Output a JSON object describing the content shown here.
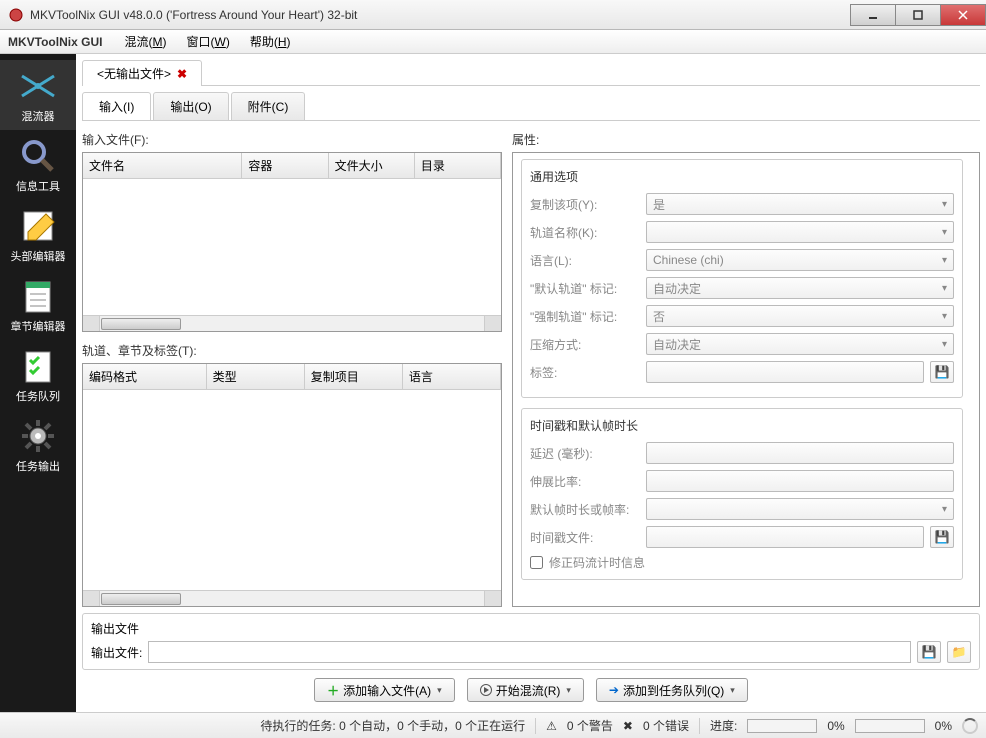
{
  "window": {
    "title": "MKVToolNix GUI v48.0.0 ('Fortress Around Your Heart') 32-bit"
  },
  "menubar": {
    "app_name": "MKVToolNix GUI",
    "items": [
      {
        "label": "混流",
        "accel": "M"
      },
      {
        "label": "窗口",
        "accel": "W"
      },
      {
        "label": "帮助",
        "accel": "H"
      }
    ]
  },
  "sidebar": {
    "items": [
      {
        "label": "混流器",
        "icon": "mux"
      },
      {
        "label": "信息工具",
        "icon": "info"
      },
      {
        "label": "头部编辑器",
        "icon": "header"
      },
      {
        "label": "章节编辑器",
        "icon": "chapter"
      },
      {
        "label": "任务队列",
        "icon": "queue"
      },
      {
        "label": "任务输出",
        "icon": "output"
      }
    ]
  },
  "doc_tab": {
    "label": "<无输出文件>"
  },
  "inner_tabs": {
    "input": "输入(I)",
    "output": "输出(O)",
    "attachments": "附件(C)"
  },
  "left": {
    "input_files_label": "输入文件(F):",
    "files_cols": {
      "name": "文件名",
      "container": "容器",
      "size": "文件大小",
      "dir": "目录"
    },
    "tracks_label": "轨道、章节及标签(T):",
    "tracks_cols": {
      "codec": "编码格式",
      "type": "类型",
      "copy": "复制项目",
      "lang": "语言"
    }
  },
  "right": {
    "props_label": "属性:",
    "general": {
      "title": "通用选项",
      "copy_label": "复制该项(Y):",
      "copy_value": "是",
      "trackname_label": "轨道名称(K):",
      "trackname_value": "",
      "lang_label": "语言(L):",
      "lang_value": "Chinese (chi)",
      "default_flag_label": "\"默认轨道\" 标记:",
      "default_flag_value": "自动决定",
      "forced_flag_label": "\"强制轨道\" 标记:",
      "forced_flag_value": "否",
      "compression_label": "压缩方式:",
      "compression_value": "自动决定",
      "tags_label": "标签:",
      "tags_value": ""
    },
    "timing": {
      "title": "时间戳和默认帧时长",
      "delay_label": "延迟 (毫秒):",
      "delay_value": "",
      "stretch_label": "伸展比率:",
      "stretch_value": "",
      "duration_label": "默认帧时长或帧率:",
      "duration_value": "",
      "tsfile_label": "时间戳文件:",
      "tsfile_value": "",
      "fixbs_label": "修正码流计时信息"
    }
  },
  "output": {
    "section_title": "输出文件",
    "label": "输出文件:",
    "value": ""
  },
  "buttons": {
    "add": "添加输入文件(A)",
    "start": "开始混流(R)",
    "queue": "添加到任务队列(Q)"
  },
  "status": {
    "pending": "待执行的任务: 0 个自动，0 个手动，0 个正在运行",
    "warnings": "0 个警告",
    "errors": "0 个错误",
    "progress_label": "进度:",
    "progress1": "0%",
    "progress2": "0%"
  }
}
